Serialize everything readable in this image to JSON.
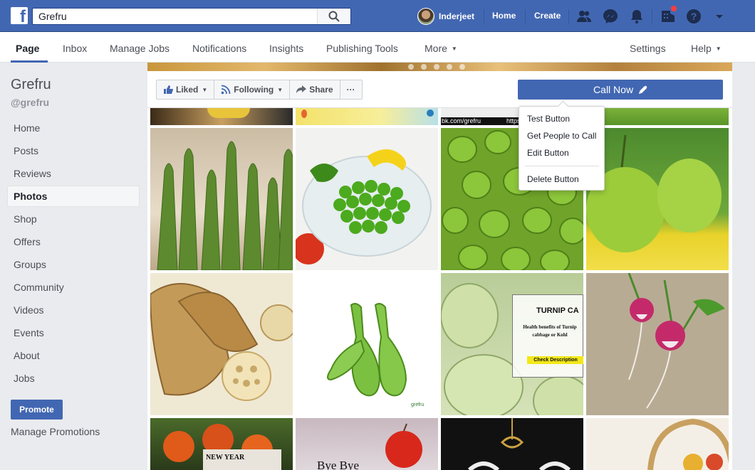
{
  "topbar": {
    "logo_letter": "f",
    "search_value": "Grefru",
    "user_name": "Inderjeet",
    "links": [
      "Home",
      "Create"
    ]
  },
  "pagenav": {
    "tabs": [
      "Page",
      "Inbox",
      "Manage Jobs",
      "Notifications",
      "Insights",
      "Publishing Tools",
      "More"
    ],
    "right": [
      "Settings",
      "Help"
    ]
  },
  "sidebar": {
    "page_name": "Grefru",
    "handle": "@grefru",
    "items": [
      "Home",
      "Posts",
      "Reviews",
      "Photos",
      "Shop",
      "Offers",
      "Groups",
      "Community",
      "Videos",
      "Events",
      "About",
      "Jobs"
    ],
    "promote_label": "Promote",
    "manage_promotions": "Manage Promotions"
  },
  "actions": {
    "liked": "Liked",
    "following": "Following",
    "share": "Share",
    "more": "···",
    "call_now": "Call Now"
  },
  "dropdown": {
    "items": [
      "Test Button",
      "Get People to Call",
      "Edit Button"
    ],
    "delete": "Delete Button"
  },
  "photos": {
    "strip_text": "bk.com/grefru",
    "strip_text2": "https://ww",
    "kohlrabi_title": "TURNIP CA",
    "kohlrabi_body": "Health benefits of Turnip cabbage or Kohl",
    "kohlrabi_button": "Check Description",
    "watermark": "grefru",
    "newyear": "NEW YEAR",
    "byebye": "Bye Bye"
  }
}
